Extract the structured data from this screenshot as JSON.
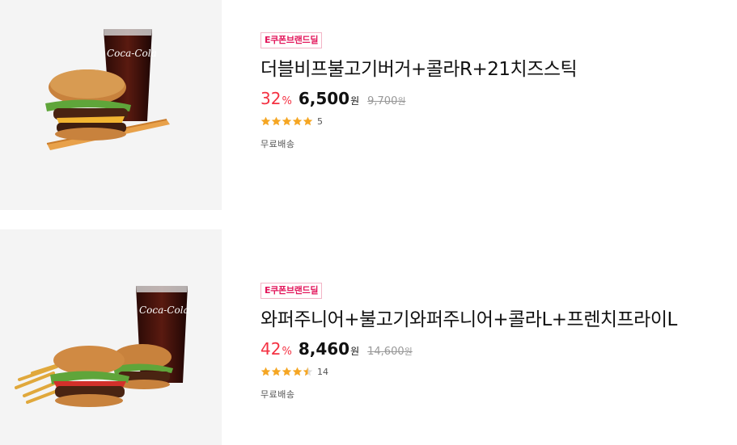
{
  "products": [
    {
      "image_label": "Coca-Cola",
      "badge": "E쿠폰브랜드딜",
      "title": "더블비프불고기버거+콜라R+21치즈스틱",
      "discount_rate": "32",
      "discount_unit": "%",
      "price": "6,500",
      "price_unit": "원",
      "original_price": "9,700",
      "original_unit": "원",
      "rating": 5,
      "review_count": "5",
      "shipping": "무료배송",
      "star_color": "#f5a623"
    },
    {
      "image_label": "Coca-Cola",
      "badge": "E쿠폰브랜드딜",
      "title": "와퍼주니어+불고기와퍼주니어+콜라L+프렌치프라이L",
      "discount_rate": "42",
      "discount_unit": "%",
      "price": "8,460",
      "price_unit": "원",
      "original_price": "14,600",
      "original_unit": "원",
      "rating": 4.5,
      "review_count": "14",
      "shipping": "무료배송",
      "star_color": "#f5a623"
    }
  ],
  "colors": {
    "accent": "#e3165b",
    "discount": "#f43142",
    "thumb_bg": "#f4f4f4"
  }
}
